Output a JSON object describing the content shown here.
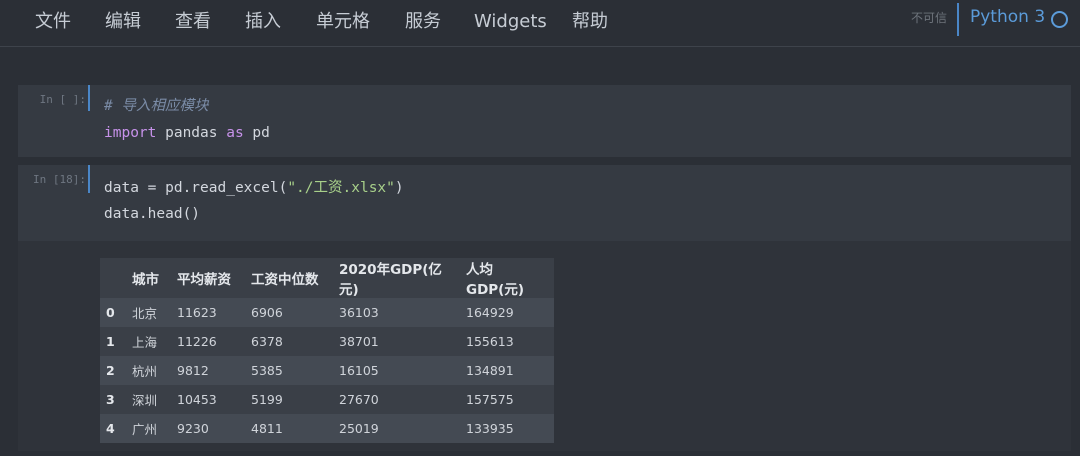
{
  "menu": [
    "文件",
    "编辑",
    "查看",
    "插入",
    "单元格",
    "服务",
    "Widgets",
    "帮助"
  ],
  "trust_status": "不可信",
  "kernel": {
    "name": "Python 3"
  },
  "cells": [
    {
      "prompt": "In [ ]:",
      "comment": "# 导入相应模块",
      "code_line2": {
        "kw1": "import",
        "mod": " pandas ",
        "kw2": "as",
        "alias": " pd"
      }
    },
    {
      "prompt": "In [18]:",
      "line1_pre": "data = pd.read_excel(",
      "line1_str": "\"./工资.xlsx\"",
      "line1_post": ")",
      "line2": "data.head()"
    }
  ],
  "table": {
    "columns": [
      "",
      "城市",
      "平均薪资",
      "工资中位数",
      "2020年GDP(亿元)",
      "人均GDP(元)"
    ],
    "rows": [
      [
        "0",
        "北京",
        "11623",
        "6906",
        "36103",
        "164929"
      ],
      [
        "1",
        "上海",
        "11226",
        "6378",
        "38701",
        "155613"
      ],
      [
        "2",
        "杭州",
        "9812",
        "5385",
        "16105",
        "134891"
      ],
      [
        "3",
        "深圳",
        "10453",
        "5199",
        "27670",
        "157575"
      ],
      [
        "4",
        "广州",
        "9230",
        "4811",
        "25019",
        "133935"
      ]
    ]
  }
}
